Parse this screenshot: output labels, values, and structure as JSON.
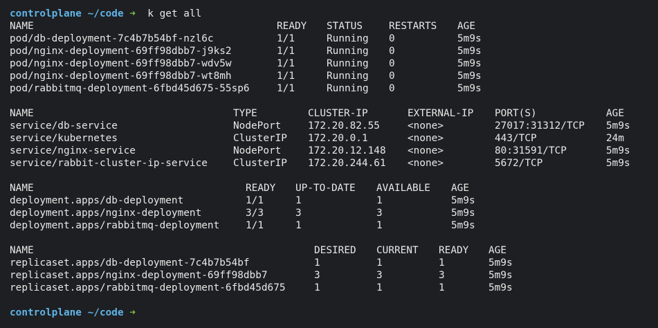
{
  "colors": {
    "background": "#1e1f22",
    "text": "#e8e8e8",
    "prompt": "#5fb4e6",
    "arrow": "#7ec24a"
  },
  "prompt": {
    "host": "controlplane",
    "dir": "~/code",
    "arrow": "➜",
    "command": "k get all"
  },
  "pods": {
    "headers": [
      "NAME",
      "READY",
      "STATUS",
      "RESTARTS",
      "AGE"
    ],
    "rows": [
      [
        "pod/db-deployment-7c4b7b54bf-nzl6c",
        "1/1",
        "Running",
        "0",
        "5m9s"
      ],
      [
        "pod/nginx-deployment-69ff98dbb7-j9ks2",
        "1/1",
        "Running",
        "0",
        "5m9s"
      ],
      [
        "pod/nginx-deployment-69ff98dbb7-wdv5w",
        "1/1",
        "Running",
        "0",
        "5m9s"
      ],
      [
        "pod/nginx-deployment-69ff98dbb7-wt8mh",
        "1/1",
        "Running",
        "0",
        "5m9s"
      ],
      [
        "pod/rabbitmq-deployment-6fbd45d675-55sp6",
        "1/1",
        "Running",
        "0",
        "5m9s"
      ]
    ]
  },
  "services": {
    "headers": [
      "NAME",
      "TYPE",
      "CLUSTER-IP",
      "EXTERNAL-IP",
      "PORT(S)",
      "AGE"
    ],
    "rows": [
      [
        "service/db-service",
        "NodePort",
        "172.20.82.55",
        "<none>",
        "27017:31312/TCP",
        "5m9s"
      ],
      [
        "service/kubernetes",
        "ClusterIP",
        "172.20.0.1",
        "<none>",
        "443/TCP",
        "24m"
      ],
      [
        "service/nginx-service",
        "NodePort",
        "172.20.12.148",
        "<none>",
        "80:31591/TCP",
        "5m9s"
      ],
      [
        "service/rabbit-cluster-ip-service",
        "ClusterIP",
        "172.20.244.61",
        "<none>",
        "5672/TCP",
        "5m9s"
      ]
    ]
  },
  "deployments": {
    "headers": [
      "NAME",
      "READY",
      "UP-TO-DATE",
      "AVAILABLE",
      "AGE"
    ],
    "rows": [
      [
        "deployment.apps/db-deployment",
        "1/1",
        "1",
        "1",
        "5m9s"
      ],
      [
        "deployment.apps/nginx-deployment",
        "3/3",
        "3",
        "3",
        "5m9s"
      ],
      [
        "deployment.apps/rabbitmq-deployment",
        "1/1",
        "1",
        "1",
        "5m9s"
      ]
    ]
  },
  "replicasets": {
    "headers": [
      "NAME",
      "DESIRED",
      "CURRENT",
      "READY",
      "AGE"
    ],
    "rows": [
      [
        "replicaset.apps/db-deployment-7c4b7b54bf",
        "1",
        "1",
        "1",
        "5m9s"
      ],
      [
        "replicaset.apps/nginx-deployment-69ff98dbb7",
        "3",
        "3",
        "3",
        "5m9s"
      ],
      [
        "replicaset.apps/rabbitmq-deployment-6fbd45d675",
        "1",
        "1",
        "1",
        "5m9s"
      ]
    ]
  }
}
